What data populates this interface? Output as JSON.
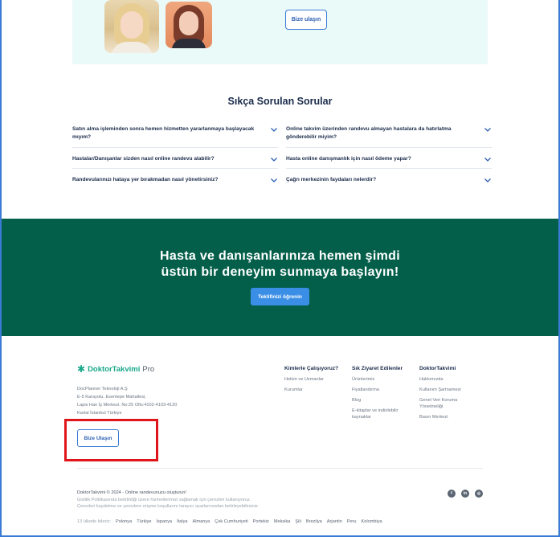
{
  "promo": {
    "contact_button": "Bize ulaşın"
  },
  "faq": {
    "title": "Sıkça Sorulan Sorular",
    "left": [
      "Satın alma işleminden sonra hemen hizmetten yararlanmaya başlayacak mıyım?",
      "Hastalar/Danışanlar sizden nasıl online randevu alabilir?",
      "Randevularınızı hataya yer bırakmadan nasıl yönetirsiniz?"
    ],
    "right": [
      "Online takvim üzerinden randevu almayan hastalara da hatırlatma gönderebilir miyim?",
      "Hasta online danışmanlık için nasıl ödeme yapar?",
      "Çağrı merkezinin faydaları nelerdir?"
    ]
  },
  "cta": {
    "title_line1": "Hasta ve danışanlarınıza hemen şimdi",
    "title_line2": "üstün bir deneyim sunmaya başlayın!",
    "button": "Teklifinizi öğrenin",
    "background_color": "#035f4a"
  },
  "footer": {
    "logo_brand": "DoktorTakvimi",
    "logo_suffix": "Pro",
    "address": [
      "DocPlanner Teknoloji A.Ş",
      "E-5 Karayolu, Esentepe Mahallesi,",
      "Lapis Han İş Merkezi, No:25 Ofis:4102-4103-4120",
      "Kartal İstanbul Türkiye"
    ],
    "contact_button": "Bize Ulaşın",
    "columns": [
      {
        "title": "Kimlerle Çalışıyoruz?",
        "links": [
          "Hekim ve Uzmanlar",
          "Kurumlar"
        ]
      },
      {
        "title": "Sık Ziyaret Edilenler",
        "links": [
          "Ürünlerimiz",
          "Fiyatlandırma",
          "Blog",
          "E-kitaplar ve indirilebilir kaynaklar"
        ]
      },
      {
        "title": "DoktorTakvimi",
        "links": [
          "Hakkımızda",
          "Kullanım Şartnamesi",
          "Genel Veri Koruma Yönetmeliği",
          "Basın Merkezi"
        ]
      }
    ],
    "legal": {
      "line1": "DoktorTakvimi © 2024 - Online randevunuzu oluşturun!",
      "line2": "Gizlilik Politikasında belirtildiği üzere hizmetlerimizi sağlamak için çerezleri kullanıyoruz.",
      "line3": "Çerezleri kaydetme ve çerezlere erişme koşullarını tarayıcı ayarlarınızdan belirleyebilirsiniz."
    },
    "socials": [
      "facebook-icon",
      "linkedin-icon",
      "instagram-icon"
    ],
    "countries_label": "13 ülkede lideriz:",
    "countries": [
      "Polonya",
      "Türkiye",
      "İspanya",
      "İtalya",
      "Almanya",
      "Çek Cumhuriyeti",
      "Portekiz",
      "Meksika",
      "Şili",
      "Brezilya",
      "Arjantin",
      "Peru",
      "Kolombiya"
    ]
  },
  "highlight_color": "#e0151a"
}
